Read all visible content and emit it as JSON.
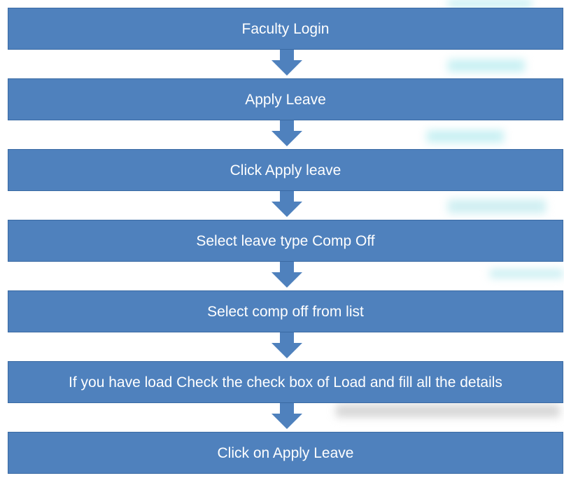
{
  "flowchart": {
    "steps": [
      {
        "label": "Faculty Login"
      },
      {
        "label": "Apply Leave"
      },
      {
        "label": "Click Apply leave"
      },
      {
        "label": "Select leave type Comp Off"
      },
      {
        "label": "Select comp off from list"
      },
      {
        "label": "If you have load Check the check box of Load and fill all the details"
      },
      {
        "label": "Click on Apply Leave"
      }
    ],
    "colors": {
      "step_fill": "#4f81bd",
      "step_border": "#3a6aa3",
      "arrow": "#4f81bd",
      "text": "#ffffff"
    }
  }
}
